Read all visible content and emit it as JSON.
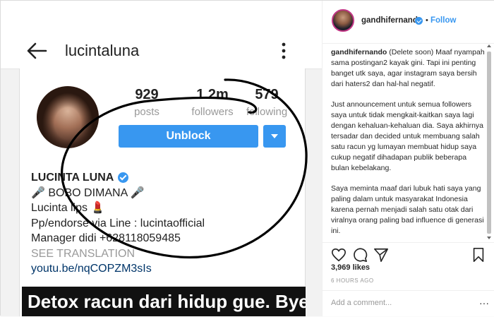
{
  "media": {
    "header": {
      "username": "lucintaluna"
    },
    "profile": {
      "stats": [
        {
          "count": "929",
          "label": "posts"
        },
        {
          "count": "1.2m",
          "label": "followers"
        },
        {
          "count": "579",
          "label": "following"
        }
      ],
      "unblock_label": "Unblock",
      "name": "LUCINTA LUNA",
      "bio_lines": [
        "🎤 BOBO DIMANA 🎤",
        "Lucinta lips 💄",
        "Pp/endorse via Line : lucintaofficial",
        "Manager didi +628118059485"
      ],
      "see_translation": "SEE TRANSLATION",
      "link": "youtu.be/nqCOPZM3sIs"
    },
    "caption_overlay": "Detox racun dari hidup gue. Bye"
  },
  "post": {
    "username": "gandhifernando",
    "follow_label": "Follow",
    "separator": "•",
    "caption_author": "gandhifernando",
    "caption_paragraphs": [
      "(Delete soon) Maaf nyampah sama postingan2 kayak gini. Tapi ini penting banget utk saya, agar instagram saya bersih dari haters2 dan hal-hal negatif.",
      "Just announcement untuk semua followers saya untuk tidak mengkait-kaitkan saya lagi dengan kehaluan-kehaluan dia. Saya akhirnya tersadar dan decided untuk membuang salah satu racun yg lumayan membuat hidup saya cukup negatif dihadapan publik beberapa bulan kebelakang.",
      "Saya meminta maaf dari lubuk hati saya yang paling dalam untuk masyarakat Indonesia karena pernah menjadi salah satu otak dari viralnya orang paling bad influence di generasi ini."
    ],
    "likes": "3,969 likes",
    "time_ago": "6 HOURS AGO",
    "add_comment_placeholder": "Add a comment...",
    "more_label": "···"
  },
  "colors": {
    "accent": "#3897f0",
    "scribble": "#000000"
  }
}
